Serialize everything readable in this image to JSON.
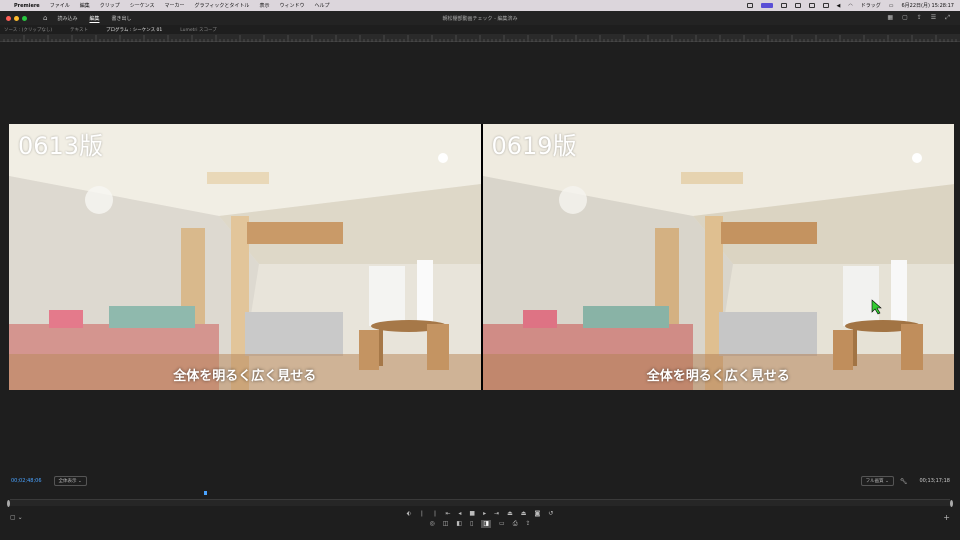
{
  "menubar": {
    "apple": "",
    "app": "Premiere",
    "items": [
      "ファイル",
      "編集",
      "クリップ",
      "シーケンス",
      "マーカー",
      "グラフィックとタイトル",
      "表示",
      "ウィンドウ",
      "ヘルプ"
    ],
    "clock": "6月22日(月) 15:28:17",
    "user": "ドラッグ"
  },
  "header": {
    "modes": [
      "読み込み",
      "編集",
      "書き出し"
    ],
    "active_mode": "編集",
    "title": "朝松棚部動画チェック - 編集済み"
  },
  "tabs": [
    "ソース : (クリップなし)",
    "テキスト",
    "プログラム : シーケンス 01",
    "Lumetri スコープ"
  ],
  "active_tab": "プログラム : シーケンス 01",
  "monitor": {
    "left_label": "0613版",
    "right_label": "0619版",
    "left_caption": "全体を明るく広く見せる",
    "right_caption": "全体を明るく広く見せる"
  },
  "controls": {
    "timecode_current": "00;02;48;06",
    "fit_select": "全体表示",
    "quality_select": "フル画質",
    "timecode_duration": "00;13;17;18"
  },
  "colors": {
    "accent_blue": "#4aa3ff",
    "panel_bg": "#1e1e1e",
    "menubar_bg": "#dcd6dc"
  }
}
